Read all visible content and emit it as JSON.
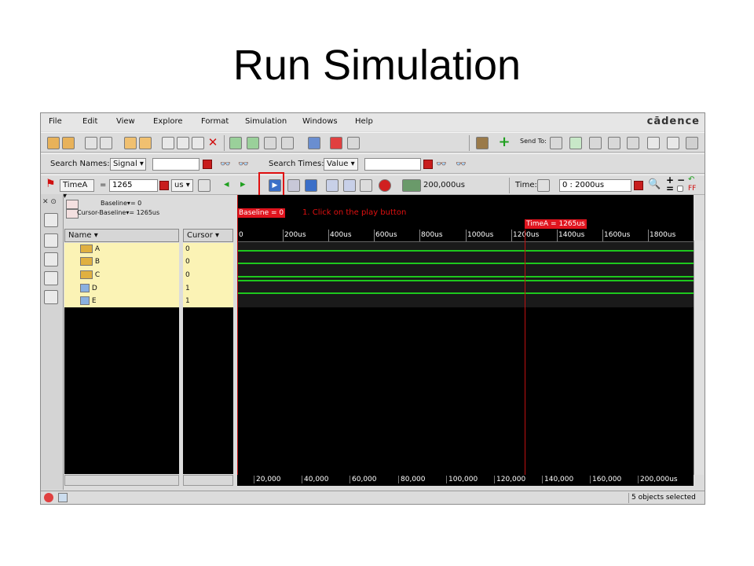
{
  "slide": {
    "title": "Run Simulation"
  },
  "menu": [
    "File",
    "Edit",
    "View",
    "Explore",
    "Format",
    "Simulation",
    "Windows",
    "Help"
  ],
  "brand": "cādence",
  "toolbar1": {
    "send_to_label": "Send To:"
  },
  "search": {
    "names_label": "Search Names:",
    "names_type": "Signal",
    "names_value": "",
    "times_label": "Search Times:",
    "times_type": "Value",
    "times_value": ""
  },
  "toolbar3": {
    "cursor_name": "TimeA",
    "equals": "=",
    "cursor_value": "1265",
    "unit": "us",
    "sim_time": "200,000us",
    "time_label": "Time:",
    "time_range": "0 : 2000us"
  },
  "cursor_info": {
    "baseline_label": "Baseline",
    "baseline_value": "= 0",
    "delta_label": "Cursor-Baseline",
    "delta_value": "= 1265us"
  },
  "columns": {
    "name": "Name",
    "cursor": "Cursor"
  },
  "signals": [
    {
      "name": "A",
      "value": "0"
    },
    {
      "name": "B",
      "value": "0"
    },
    {
      "name": "C",
      "value": "0"
    },
    {
      "name": "D",
      "value": "1"
    },
    {
      "name": "E",
      "value": "1"
    }
  ],
  "waveform": {
    "baseline_tag": "Baseline = 0",
    "cursor_tag": "TimeA = 1265us",
    "annotation": "1.  Click on the play button",
    "ticks": [
      "0",
      "200us",
      "400us",
      "600us",
      "800us",
      "1000us",
      "1200us",
      "1400us",
      "1600us",
      "1800us"
    ],
    "overview_ticks": [
      "20,000",
      "40,000",
      "60,000",
      "80,000",
      "100,000",
      "120,000",
      "140,000",
      "160,000",
      "200,000us"
    ]
  },
  "status": {
    "selection": "5 objects selected"
  },
  "colors": {
    "trace": "#1ec81e",
    "cursor": "#e0141e",
    "highlight": "#e01010"
  }
}
